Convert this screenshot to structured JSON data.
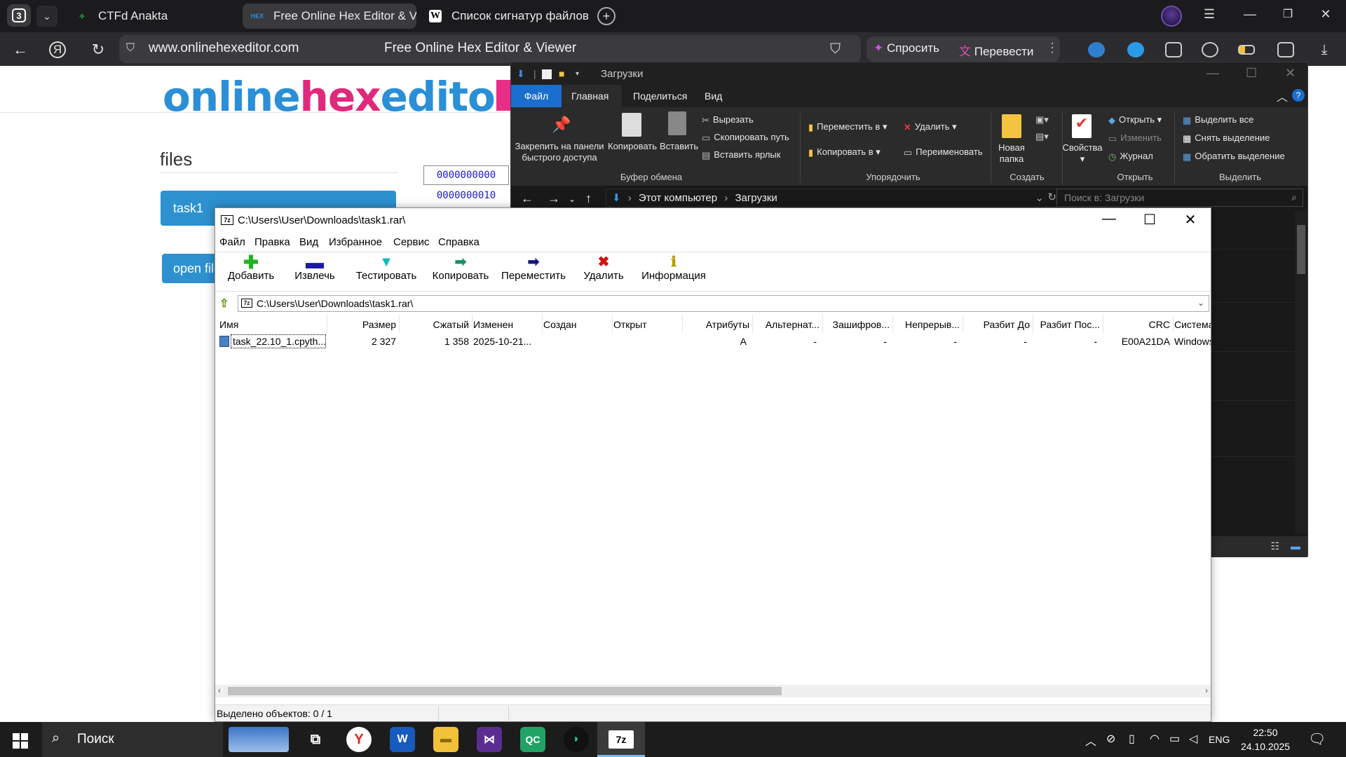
{
  "browser": {
    "tab_count": "3",
    "tabs": [
      {
        "label": "CTFd Anakta",
        "favicon": "ctfd-icon"
      },
      {
        "label": "Free Online Hex Editor & Viewer",
        "favicon": "hex-icon"
      },
      {
        "label": "Список сигнатур файлов",
        "favicon": "wikipedia-icon"
      }
    ],
    "favicon_hex": "HEX",
    "favicon_wiki": "W",
    "url": "www.onlinehexeditor.com",
    "page_title": "Free Online Hex Editor & Viewer",
    "ask_label": "Спросить",
    "translate_label": "Перевести",
    "accent_color": "#3a3a3d"
  },
  "site": {
    "logo_part1": "online",
    "logo_part2": "hex",
    "logo_part3": "editor",
    "files_heading": "files",
    "file_item": "task1",
    "open_file_label": "open file",
    "hex_offset_1": "0000000000",
    "hex_offset_2": "0000000010",
    "brand_blue": "#2a8fd6",
    "brand_pink": "#e0297d"
  },
  "explorer": {
    "title": "Загрузки",
    "menu": {
      "file": "Файл",
      "home": "Главная",
      "share": "Поделиться",
      "view": "Вид"
    },
    "ribbon": {
      "pin": "Закрепить на панели быстрого доступа",
      "pin_line1": "Закрепить на панели",
      "pin_line2": "быстрого доступа",
      "copy": "Копировать",
      "paste": "Вставить",
      "cut": "Вырезать",
      "copy_path": "Скопировать путь",
      "paste_shortcut": "Вставить ярлык",
      "group_clipboard": "Буфер обмена",
      "move_to": "Переместить в",
      "copy_to": "Копировать в",
      "delete": "Удалить",
      "rename": "Переименовать",
      "group_organize": "Упорядочить",
      "new_folder_line1": "Новая",
      "new_folder_line2": "папка",
      "group_create": "Создать",
      "properties": "Свойства",
      "open": "Открыть",
      "edit": "Изменить",
      "history": "Журнал",
      "group_open": "Открыть",
      "select_all": "Выделить все",
      "select_none": "Снять выделение",
      "invert_selection": "Обратить выделение",
      "group_select": "Выделить"
    },
    "path": [
      "Этот компьютер",
      "Загрузки"
    ],
    "search_placeholder": "Поиск в: Загрузки"
  },
  "sevenzip": {
    "title": "C:\\Users\\User\\Downloads\\task1.rar\\",
    "app_icon": "7z",
    "menu": [
      "Файл",
      "Правка",
      "Вид",
      "Избранное",
      "Сервис",
      "Справка"
    ],
    "toolbar": [
      {
        "label": "Добавить",
        "icon": "plus-icon",
        "color": "#1db51d"
      },
      {
        "label": "Извлечь",
        "icon": "minus-icon",
        "color": "#1a1aa6"
      },
      {
        "label": "Тестировать",
        "icon": "check-icon",
        "color": "#15b8b8"
      },
      {
        "label": "Копировать",
        "icon": "copy-arrow-icon",
        "color": "#1c8f6c"
      },
      {
        "label": "Переместить",
        "icon": "move-arrow-icon",
        "color": "#14147a"
      },
      {
        "label": "Удалить",
        "icon": "delete-x-icon",
        "color": "#d01010"
      },
      {
        "label": "Информация",
        "icon": "info-icon",
        "color": "#b49a00"
      }
    ],
    "path": "C:\\Users\\User\\Downloads\\task1.rar\\",
    "columns": [
      "Имя",
      "Размер",
      "Сжатый",
      "Изменен",
      "Создан",
      "Открыт",
      "Атрибуты",
      "Альтернат...",
      "Зашифров...",
      "Непрерыв...",
      "Разбит До",
      "Разбит Пос...",
      "CRC",
      "Система"
    ],
    "rows": [
      {
        "name": "task_22.10_1.cpyth...",
        "size": "2 327",
        "packed": "1 358",
        "modified": "2025-10-21...",
        "created": "",
        "accessed": "",
        "attributes": "A",
        "alt": "-",
        "encrypted": "-",
        "solid": "-",
        "split_before": "-",
        "split_after": "-",
        "crc": "E00A21DA",
        "host_os": "Windows"
      }
    ],
    "status": "Выделено объектов: 0 / 1"
  },
  "taskbar": {
    "search_label": "Поиск",
    "apps": [
      "task-view-icon",
      "yandex-browser-icon",
      "word-icon",
      "file-explorer-icon",
      "visual-studio-icon",
      "qc-icon",
      "pycharm-icon",
      "7zip-icon"
    ],
    "language": "ENG",
    "time": "22:50",
    "date": "24.10.2025"
  }
}
